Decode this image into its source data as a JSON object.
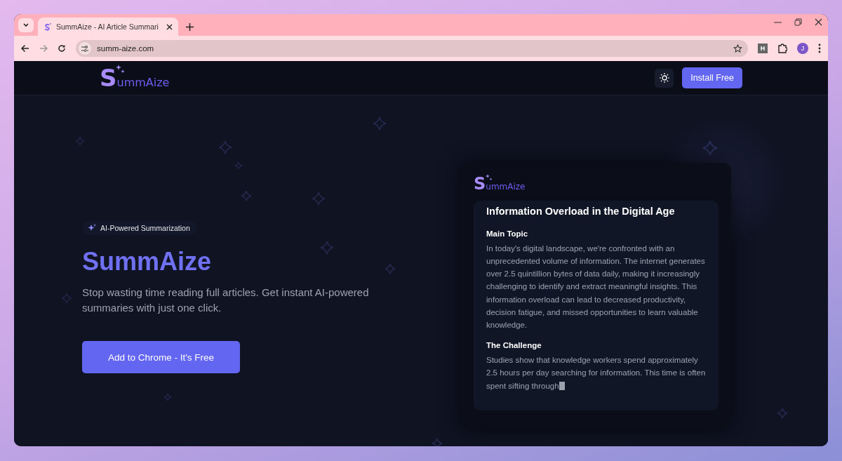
{
  "browser": {
    "tab": {
      "title": "SummAize - AI Article Summari",
      "selected": true
    },
    "address": "summ-aize.com",
    "profile_initial": "J",
    "extension_letter": "H"
  },
  "header": {
    "logo": "SummAize",
    "install_button": "Install Free"
  },
  "hero": {
    "badge": "AI-Powered Summarization",
    "title": "SummAize",
    "subtitle": "Stop wasting time reading full articles. Get instant AI-powered summaries with just one click.",
    "cta": "Add to Chrome - It's Free"
  },
  "preview": {
    "logo": "SummAize",
    "heading": "Information Overload in the Digital Age",
    "sections": [
      {
        "title": "Main Topic",
        "text": "In today's digital landscape, we're confronted with an unprecedented volume of information. The internet generates over 2.5 quintillion bytes of data daily, making it increasingly challenging to identify and extract meaningful insights. This information overload can lead to decreased productivity, decision fatigue, and missed opportunities to learn valuable knowledge.",
        "typing": false
      },
      {
        "title": "The Challenge",
        "text": "Studies show that knowledge workers spend approximately 2.5 hours per day searching for information. This time is often spent sifting through",
        "typing": true
      }
    ]
  }
}
